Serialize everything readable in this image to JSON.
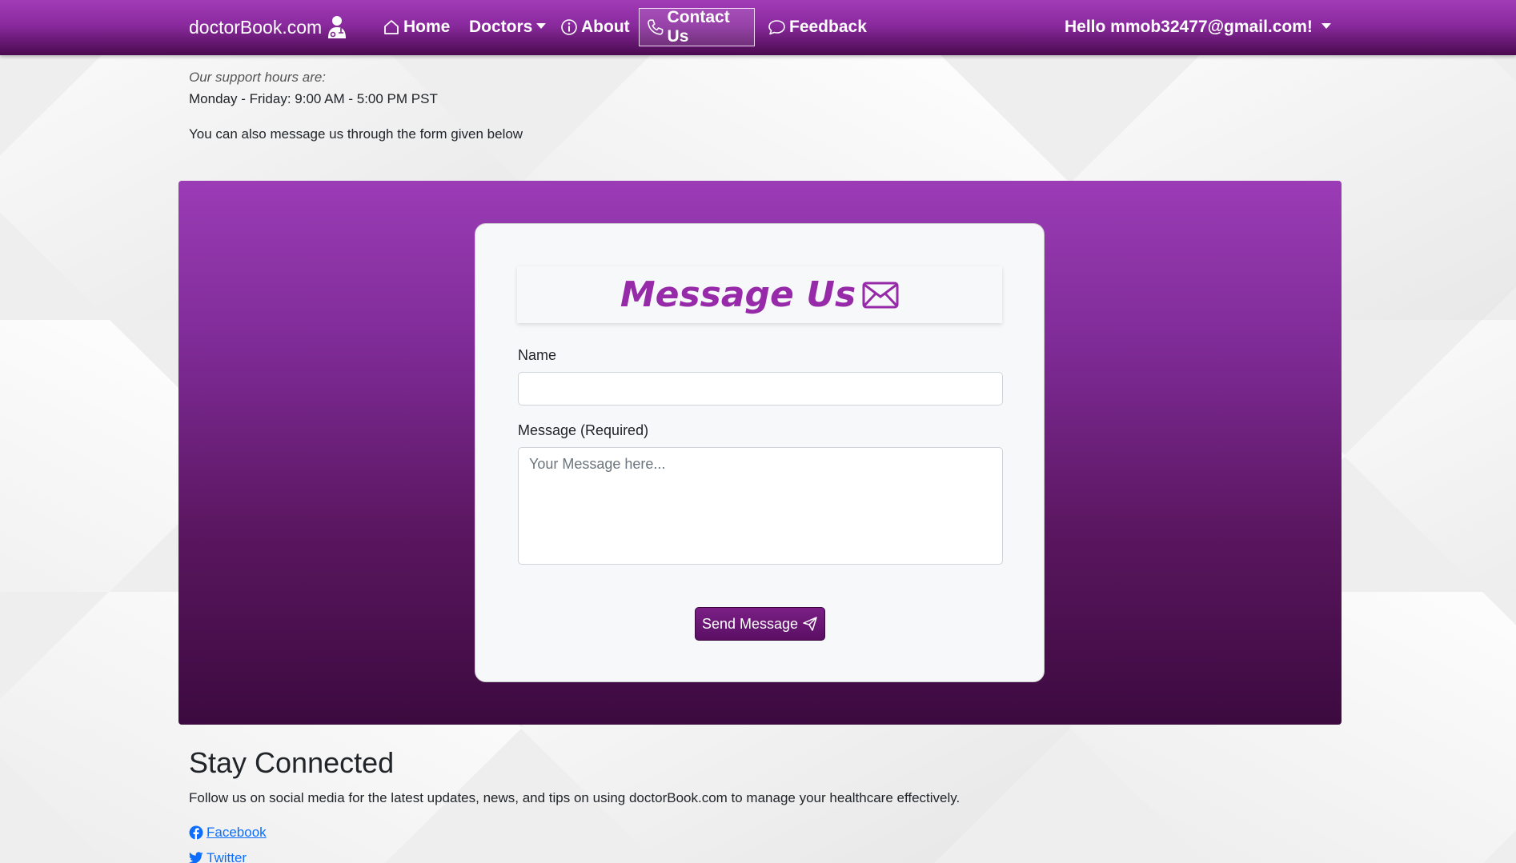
{
  "navbar": {
    "brand": "doctorBook.com",
    "items": [
      {
        "label": "Home",
        "icon": "house-icon"
      },
      {
        "label": "Doctors",
        "icon": "caret-down-icon"
      },
      {
        "label": "About",
        "icon": "info-circle-icon"
      },
      {
        "label": "Contact Us",
        "icon": "telephone-icon",
        "active": true
      },
      {
        "label": "Feedback",
        "icon": "chat-icon"
      }
    ],
    "user_greeting": "Hello mmob32477@gmail.com!"
  },
  "intro": {
    "hours_label": "Our support hours are:",
    "hours": "Monday - Friday: 9:00 AM - 5:00 PM PST",
    "form_note": "You can also message us through the form given below"
  },
  "form": {
    "title": "Message Us",
    "name_label": "Name",
    "name_value": "",
    "message_label": "Message (Required)",
    "message_placeholder": "Your Message here...",
    "message_value": "",
    "send_label": "Send Message"
  },
  "footer": {
    "title": "Stay Connected",
    "text": "Follow us on social media for the latest updates, news, and tips on using doctorBook.com to manage your healthcare effectively.",
    "links": [
      {
        "label": "Facebook",
        "icon": "facebook-icon"
      },
      {
        "label": "Twitter",
        "icon": "twitter-icon"
      }
    ]
  },
  "colors": {
    "nav_top": "#a13bb7",
    "nav_bottom": "#4a0a4f",
    "title_purple": "#962aa8",
    "button": "#5a0f63",
    "link": "#0d6efd"
  }
}
